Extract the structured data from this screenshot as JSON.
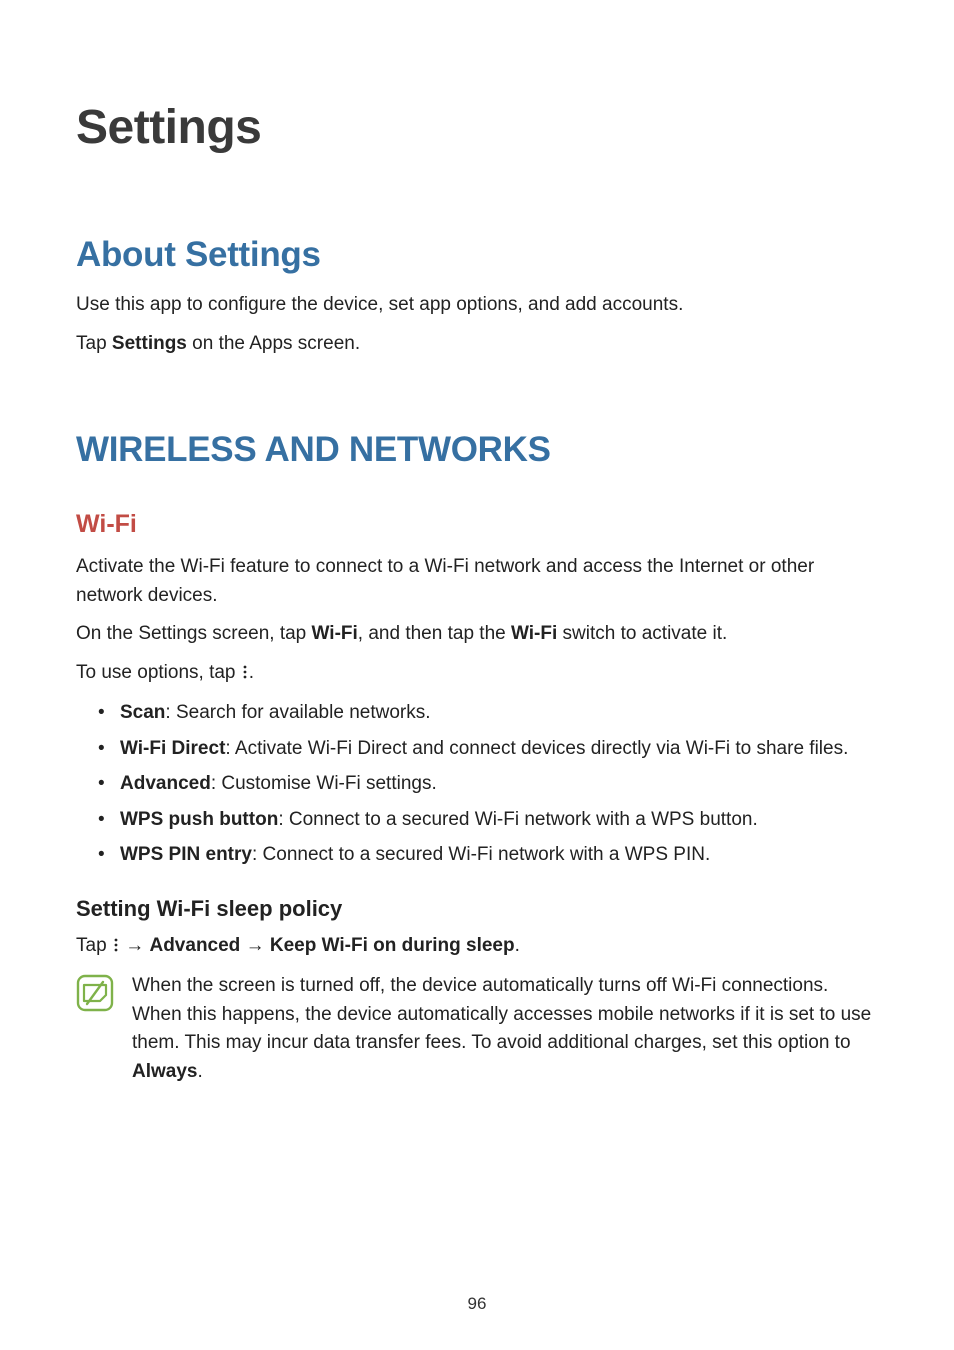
{
  "page": {
    "title": "Settings",
    "number": "96"
  },
  "about": {
    "heading": "About Settings",
    "p1": "Use this app to configure the device, set app options, and add accounts.",
    "p2_a": "Tap ",
    "p2_b": "Settings",
    "p2_c": " on the Apps screen."
  },
  "wireless": {
    "heading": "WIRELESS AND NETWORKS",
    "wifi": {
      "heading": "Wi-Fi",
      "p1": "Activate the Wi-Fi feature to connect to a Wi-Fi network and access the Internet or other network devices.",
      "p2_a": "On the Settings screen, tap ",
      "p2_b": "Wi-Fi",
      "p2_c": ", and then tap the ",
      "p2_d": "Wi-Fi",
      "p2_e": " switch to activate it.",
      "p3_a": "To use options, tap ",
      "p3_b": ".",
      "items": [
        {
          "label": "Scan",
          "desc": ": Search for available networks."
        },
        {
          "label": "Wi-Fi Direct",
          "desc": ": Activate Wi-Fi Direct and connect devices directly via Wi-Fi to share files."
        },
        {
          "label": "Advanced",
          "desc": ": Customise Wi-Fi settings."
        },
        {
          "label": "WPS push button",
          "desc": ": Connect to a secured Wi-Fi network with a WPS button."
        },
        {
          "label": "WPS PIN entry",
          "desc": ": Connect to a secured Wi-Fi network with a WPS PIN."
        }
      ],
      "sleep": {
        "heading": "Setting Wi-Fi sleep policy",
        "p_a": "Tap ",
        "arrow": " → ",
        "p_b": "Advanced",
        "p_c": "Keep Wi-Fi on during sleep",
        "p_d": ".",
        "note_a": "When the screen is turned off, the device automatically turns off Wi-Fi connections. When this happens, the device automatically accesses mobile networks if it is set to use them. This may incur data transfer fees. To avoid additional charges, set this option to ",
        "note_b": "Always",
        "note_c": "."
      }
    }
  }
}
